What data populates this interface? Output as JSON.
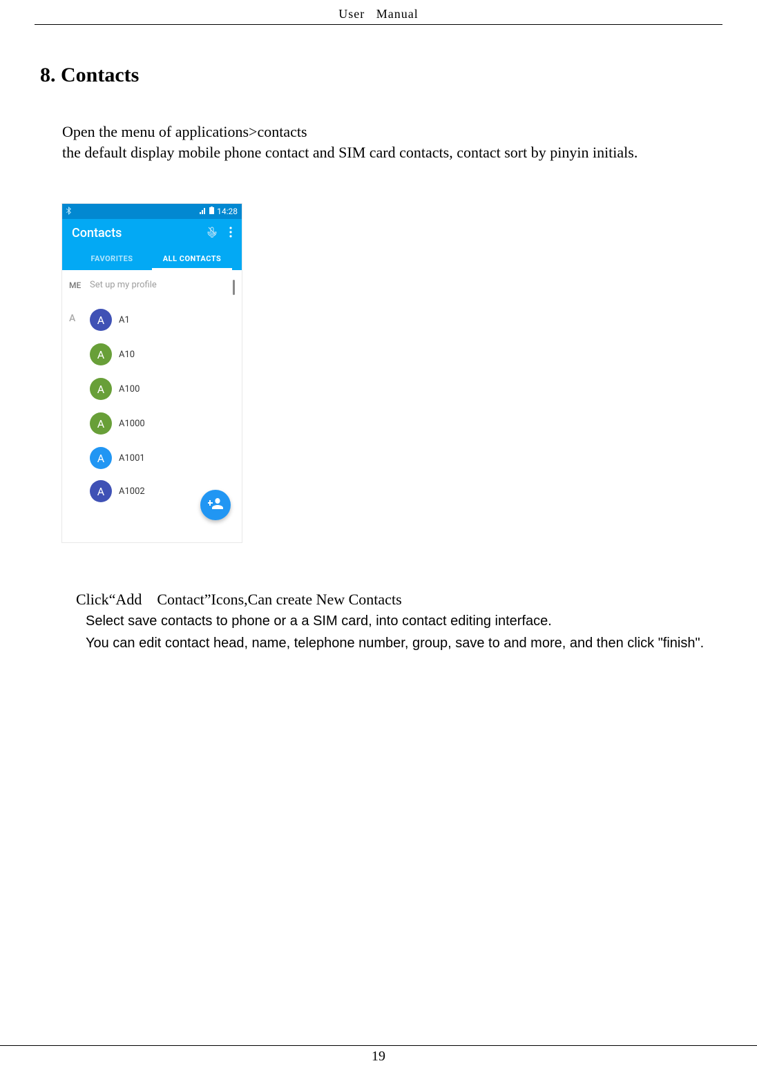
{
  "header": {
    "left": "User",
    "right": "Manual"
  },
  "section_title": "8. Contacts",
  "intro_line1": "Open the menu of applications>contacts",
  "intro_line2": "the default display mobile phone contact and SIM card contacts, contact sort by pinyin initials.",
  "phone": {
    "status_time": "14:28",
    "app_title": "Contacts",
    "tab_favorites": "FAVORITES",
    "tab_all": "ALL CONTACTS",
    "me_label": "ME",
    "me_action": "Set up my profile",
    "section_letter": "A",
    "contacts": [
      {
        "initial": "A",
        "name": "A1",
        "color": "blue"
      },
      {
        "initial": "A",
        "name": "A10",
        "color": "green"
      },
      {
        "initial": "A",
        "name": "A100",
        "color": "green"
      },
      {
        "initial": "A",
        "name": "A1000",
        "color": "green"
      },
      {
        "initial": "A",
        "name": "A1001",
        "color": "lblue"
      },
      {
        "initial": "A",
        "name": "A1002",
        "color": "blue"
      }
    ]
  },
  "instruction1": "Click“Add Contact”Icons,Can create New Contacts",
  "instruction2": "Select save contacts to phone or a a SIM card, into contact editing interface.",
  "instruction3": "You can edit contact head, name, telephone number, group, save to and more, and then click \"finish\".",
  "page_number": "19"
}
